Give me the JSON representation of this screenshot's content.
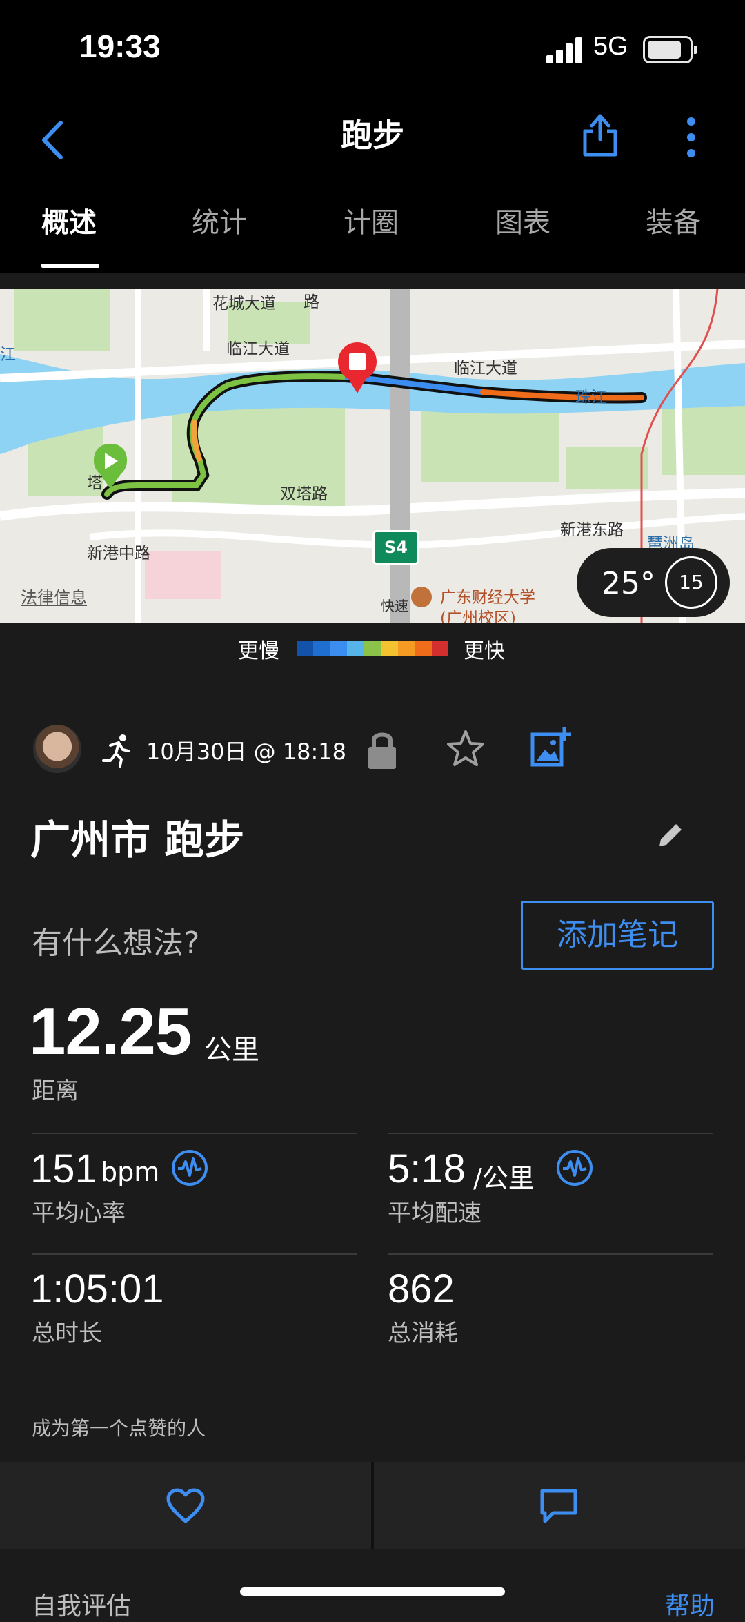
{
  "status_bar": {
    "time": "19:33",
    "network": "5G"
  },
  "header": {
    "title": "跑步",
    "tabs": [
      {
        "label": "概述",
        "active": true
      },
      {
        "label": "统计",
        "active": false
      },
      {
        "label": "计圈",
        "active": false
      },
      {
        "label": "图表",
        "active": false
      },
      {
        "label": "装备",
        "active": false
      }
    ]
  },
  "map": {
    "labels": {
      "road_1": "花城大道",
      "road_2": "临江大道",
      "road_3": "临江大道",
      "river": "珠江",
      "road_4": "双塔路",
      "road_5": "新港中路",
      "road_6": "新港东路",
      "island": "琶洲岛",
      "road_7": "路",
      "road_8": "塔",
      "highway_badge": "S4",
      "expressway": "快速",
      "university": "广东财经大学",
      "campus": "(广州校区)",
      "left_edge": "江"
    },
    "legal_link": "法律信息",
    "weather": {
      "temperature": "25°",
      "wind": "15"
    }
  },
  "speed_legend": {
    "slower": "更慢",
    "faster": "更快",
    "colors": [
      "#1352a9",
      "#1f6fd1",
      "#3b8ef0",
      "#56b4e9",
      "#8bc34a",
      "#f2c230",
      "#f59a23",
      "#ef6c1a",
      "#d32f2f"
    ]
  },
  "activity": {
    "datetime": "10月30日 @ 18:18",
    "title": "广州市 跑步",
    "thought_placeholder": "有什么想法?",
    "add_note": "添加笔记"
  },
  "stats": {
    "distance": {
      "value": "12.25",
      "unit": "公里",
      "label": "距离"
    },
    "avg_hr": {
      "value": "151",
      "unit": "bpm",
      "label": "平均心率"
    },
    "avg_pace": {
      "value": "5:18",
      "unit": "/公里",
      "label": "平均配速"
    },
    "duration": {
      "value": "1:05:01",
      "label": "总时长"
    },
    "calories": {
      "value": "862",
      "label": "总消耗"
    }
  },
  "social": {
    "likes_text": "成为第一个点赞的人"
  },
  "footer": {
    "self_eval": "自我评估",
    "help": "帮助"
  },
  "colors": {
    "accent": "#3d8ef0",
    "background": "#1b1b1b",
    "header": "#000000"
  }
}
